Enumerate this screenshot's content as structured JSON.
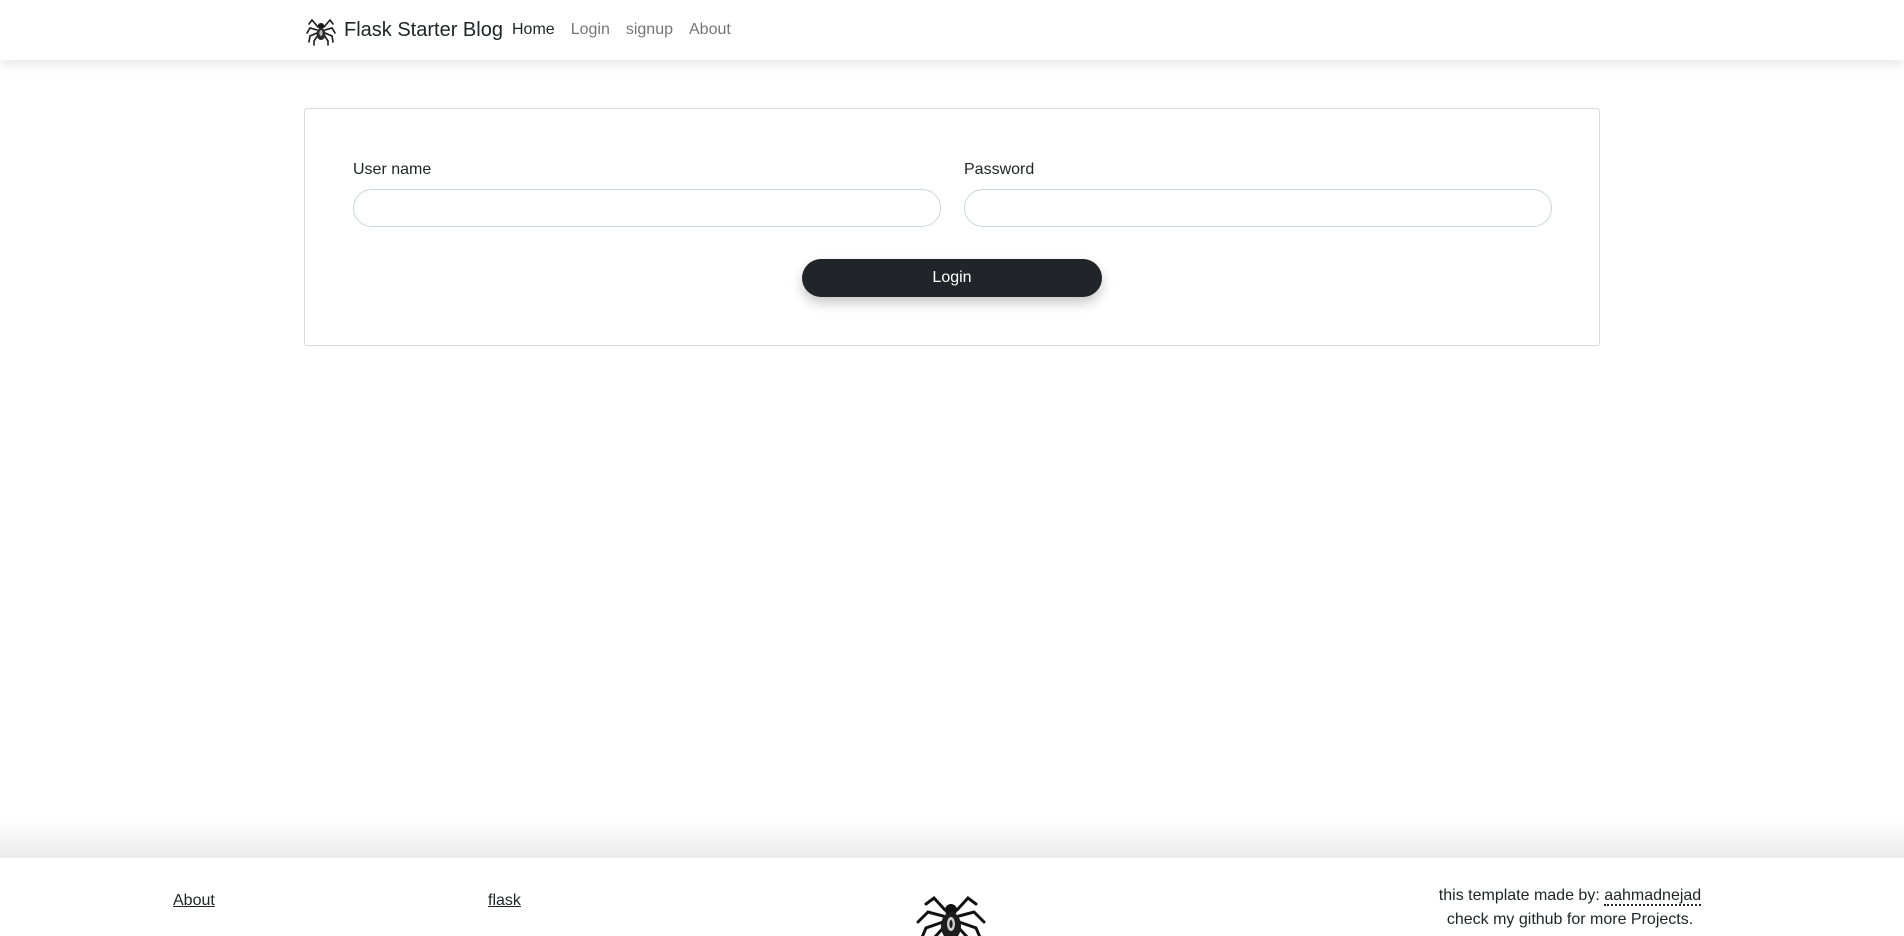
{
  "navbar": {
    "brand": "Flask Starter Blog",
    "brand_icon": "spider-icon",
    "links": [
      {
        "label": "Home",
        "active": true
      },
      {
        "label": "Login",
        "active": false
      },
      {
        "label": "signup",
        "active": false
      },
      {
        "label": "About",
        "active": false
      }
    ]
  },
  "login_form": {
    "username_label": "User name",
    "username_value": "",
    "password_label": "Password",
    "password_value": "",
    "submit_label": "Login"
  },
  "footer": {
    "about_link": "About",
    "flask_link": "flask",
    "logo_icon": "spider-icon",
    "credit_prefix": "this template made by:",
    "credit_author": "aahmadnejad",
    "credit_line2": "check my github for more Projects."
  },
  "colors": {
    "button_bg": "#212529",
    "text": "#212529",
    "muted_link": "#8c8c8c",
    "card_border": "#d9dadb"
  }
}
